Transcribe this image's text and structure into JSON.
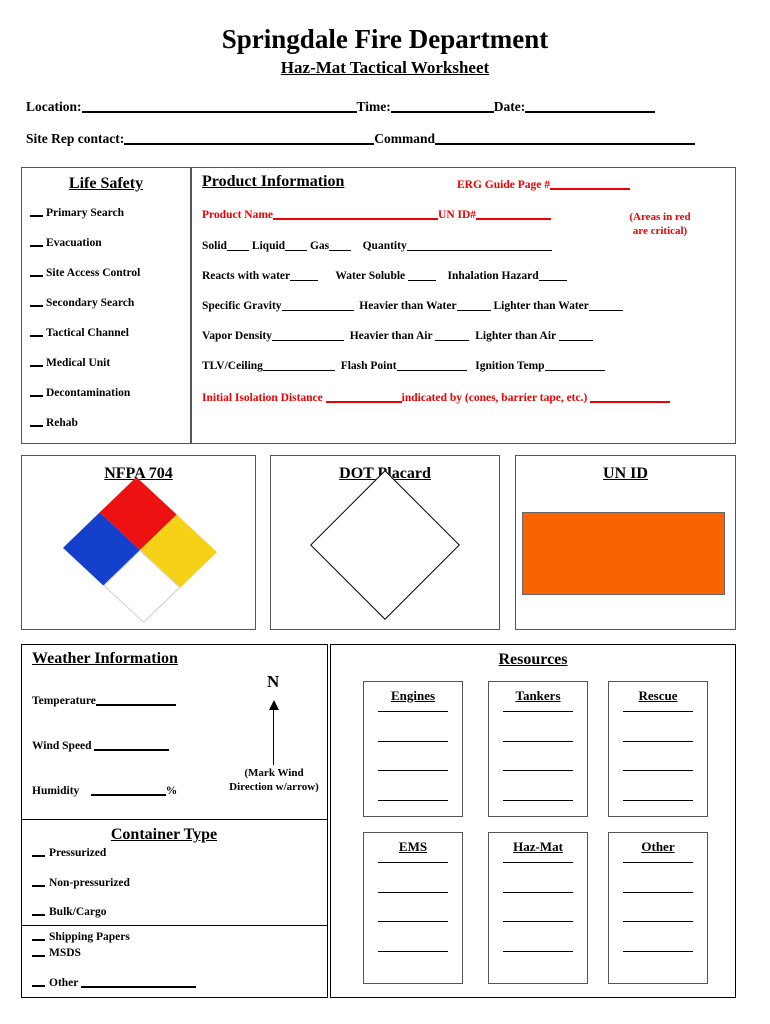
{
  "header": {
    "title": "Springdale Fire Department",
    "subtitle": "Haz-Mat Tactical Worksheet"
  },
  "fields": {
    "location_label": "Location:",
    "time_label": "Time:",
    "date_label": "Date:",
    "site_rep_label": "Site Rep contact:",
    "command_label": "Command"
  },
  "life_safety": {
    "heading": "Life Safety",
    "items": [
      "Primary Search",
      "Evacuation",
      "Site Access Control",
      "Secondary Search",
      "Tactical Channel",
      "Medical Unit",
      "Decontamination",
      "Rehab"
    ]
  },
  "product_info": {
    "heading": "Product Information",
    "erg_label": "ERG Guide Page #",
    "product_name_label": "Product Name",
    "un_id_label": "UN ID#",
    "critical_note_line1": "(Areas in red",
    "critical_note_line2": "are critical)",
    "solid_label": "Solid",
    "liquid_label": "Liquid",
    "gas_label": "Gas",
    "quantity_label": "Quantity",
    "reacts_label": "Reacts with water",
    "water_soluble_label": "Water Soluble",
    "inhalation_label": "Inhalation Hazard",
    "specific_gravity_label": "Specific Gravity",
    "heavier_water_label": "Heavier than Water",
    "lighter_water_label": "Lighter than Water",
    "vapor_density_label": "Vapor Density",
    "heavier_air_label": "Heavier than Air",
    "lighter_air_label": "Lighter than Air",
    "tlv_label": "TLV/Ceiling",
    "flash_point_label": "Flash Point",
    "ignition_temp_label": "Ignition Temp",
    "isolation_label": "Initial Isolation Distance",
    "isolation_indicated_label": "indicated by (cones, barrier tape, etc.)"
  },
  "placards": {
    "nfpa_heading": "NFPA 704",
    "dot_heading": "DOT Placard",
    "unid_heading": "UN ID"
  },
  "weather": {
    "heading": "Weather Information",
    "temperature_label": "Temperature",
    "wind_speed_label": "Wind Speed",
    "humidity_label": "Humidity",
    "percent_symbol": "%",
    "north_label": "N",
    "mark_wind_line1": "(Mark Wind",
    "mark_wind_line2": "Direction w/arrow)"
  },
  "container_type": {
    "heading": "Container Type",
    "items": [
      "Pressurized",
      "Non-pressurized",
      "Bulk/Cargo"
    ],
    "docs": [
      "Shipping Papers",
      "MSDS"
    ],
    "other_label": "Other"
  },
  "resources": {
    "heading": "Resources",
    "boxes": [
      {
        "label": "Engines",
        "lines": 4
      },
      {
        "label": "Tankers",
        "lines": 4
      },
      {
        "label": "Rescue",
        "lines": 4
      },
      {
        "label": "EMS",
        "lines": 4
      },
      {
        "label": "Haz-Mat",
        "lines": 4
      },
      {
        "label": "Other",
        "lines": 4
      }
    ]
  },
  "colors": {
    "critical_red": "#ee0000",
    "nfpa_health_blue": "#1540cc",
    "nfpa_flammability_red": "#ee1111",
    "nfpa_reactivity_yellow": "#f5d117",
    "nfpa_special_white": "#ffffff",
    "un_id_orange": "#fa6400"
  }
}
